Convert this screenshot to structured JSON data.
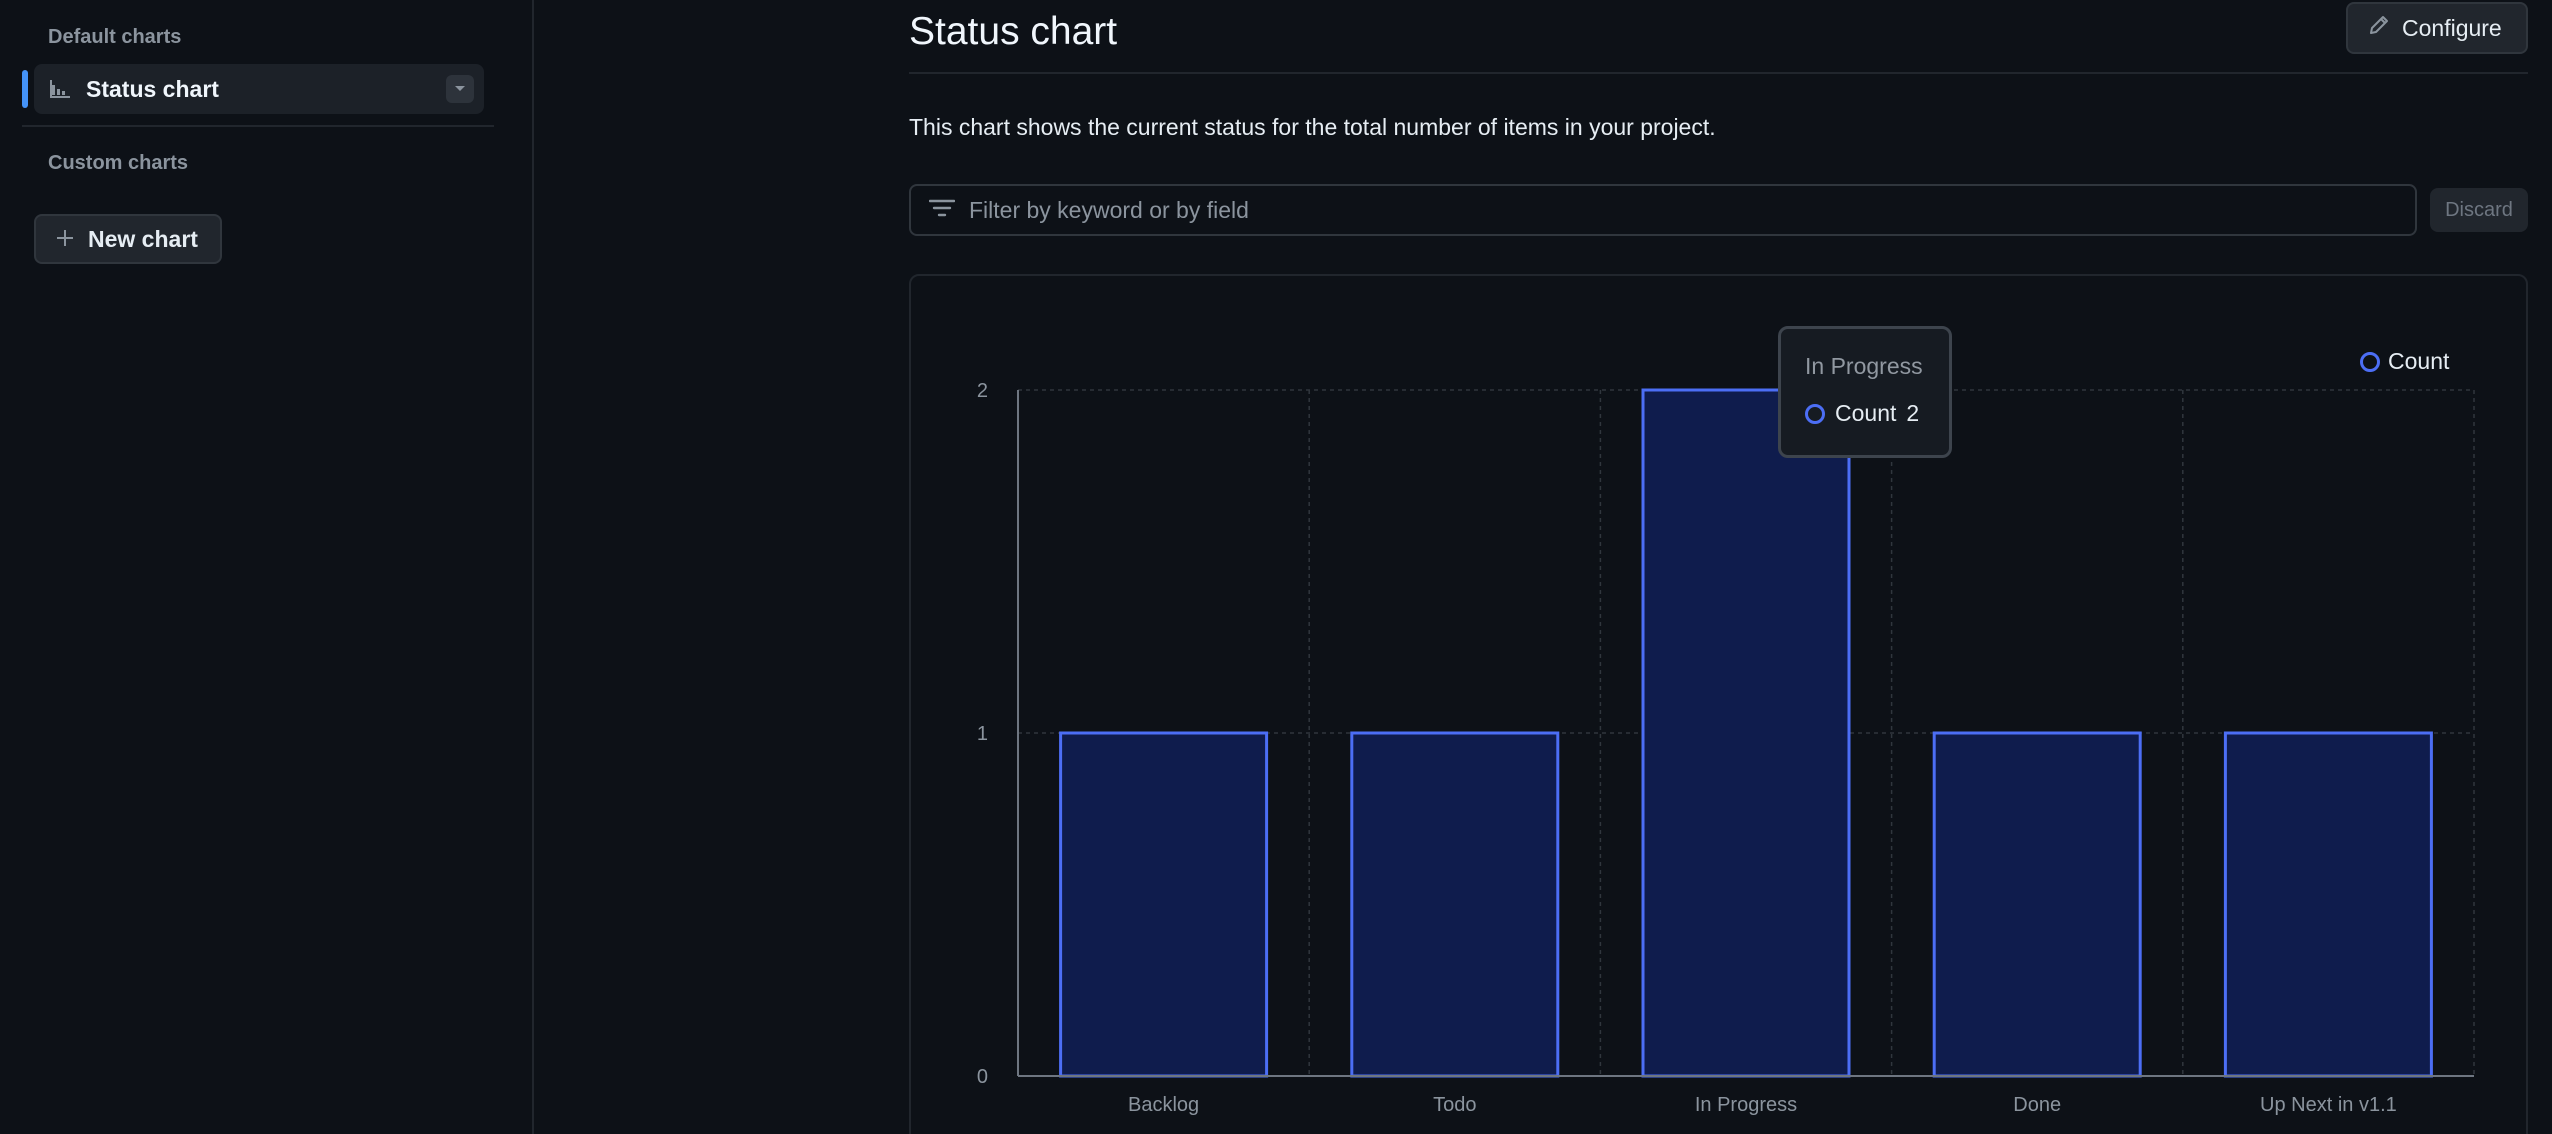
{
  "sidebar": {
    "default_label": "Default charts",
    "items": [
      {
        "label": "Status chart",
        "icon": "bar-chart-icon"
      }
    ],
    "custom_label": "Custom charts",
    "new_chart_label": "New chart"
  },
  "header": {
    "title": "Status chart",
    "configure_label": "Configure"
  },
  "description": "This chart shows the current status for the total number of items in your project.",
  "filter": {
    "placeholder": "Filter by keyword or by field",
    "discard_label": "Discard"
  },
  "tooltip": {
    "title": "In Progress",
    "series": "Count",
    "value": "2"
  },
  "colors": {
    "bar_fill": "#0f1c4d",
    "bar_stroke": "#4c6ef5",
    "accent": "#4493f8"
  },
  "chart_data": {
    "type": "bar",
    "categories": [
      "Backlog",
      "Todo",
      "In Progress",
      "Done",
      "Up Next in v1.1"
    ],
    "series": [
      {
        "name": "Count",
        "values": [
          1,
          1,
          2,
          1,
          1
        ]
      }
    ],
    "yticks": [
      0,
      1,
      2
    ],
    "ylim": [
      0,
      2
    ],
    "grid": true,
    "legend": "top-right"
  }
}
